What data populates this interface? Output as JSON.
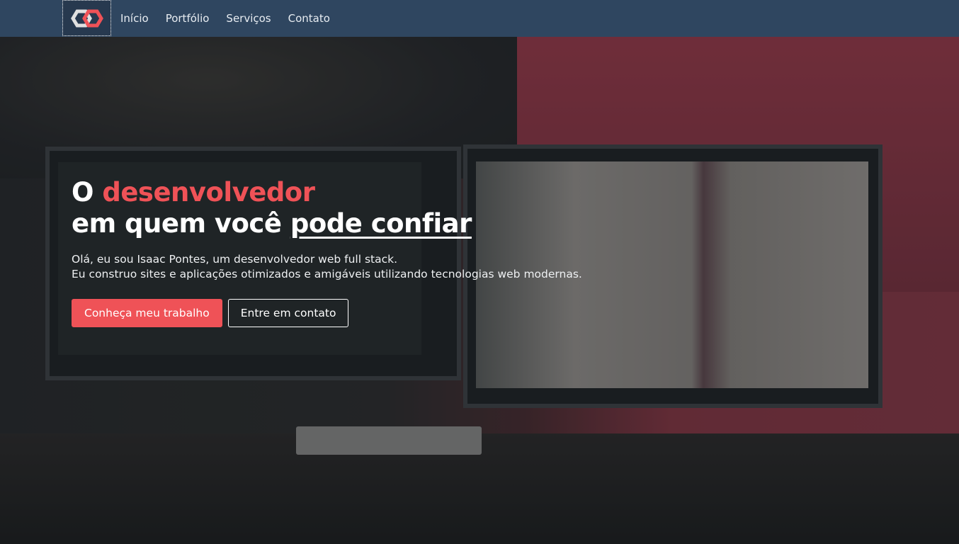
{
  "nav": {
    "logo_icon": "linked-hexagons-logo",
    "items": [
      {
        "label": "Início"
      },
      {
        "label": "Portfólio"
      },
      {
        "label": "Serviços"
      },
      {
        "label": "Contato"
      }
    ]
  },
  "hero": {
    "title_prefix": "O ",
    "title_accent": "desenvolvedor",
    "title_line2": "em quem você ",
    "title_underlined": "pode confiar",
    "intro_line1": "Olá, eu sou Isaac Pontes, um desenvolvedor web full stack.",
    "intro_line2": "Eu construo sites e aplicações otimizados e amigáveis utilizando tecnologias web modernas.",
    "primary_button": "Conheça meu trabalho",
    "secondary_button": "Entre em contato"
  },
  "colors": {
    "nav_bg": "#2f4660",
    "accent": "#ef5257",
    "logo_light": "#e0e0e0"
  }
}
